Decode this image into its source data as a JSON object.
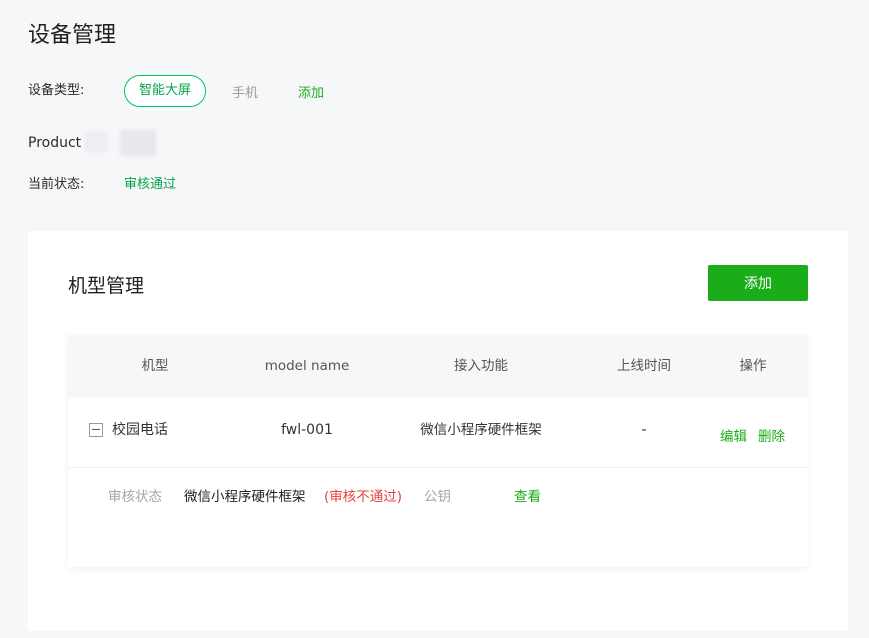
{
  "page": {
    "title": "设备管理"
  },
  "device_type": {
    "label": "设备类型:",
    "options": [
      "智能大屏",
      "手机"
    ],
    "selected": "智能大屏",
    "add_label": "添加"
  },
  "product_id": {
    "label": "Product ID"
  },
  "current_status": {
    "label": "当前状态:",
    "value": "审核通过"
  },
  "models": {
    "title": "机型管理",
    "add_button": "添加",
    "columns": [
      "机型",
      "model name",
      "接入功能",
      "上线时间",
      "操作"
    ],
    "rows": [
      {
        "model": "校园电话",
        "model_name": "fwl-001",
        "feature": "微信小程序硬件框架",
        "online_time": "-",
        "actions": [
          "编辑",
          "删除"
        ],
        "detail": {
          "label": "审核状态",
          "feature": "微信小程序硬件框架",
          "status": "(审核不通过)",
          "key_label": "公钥",
          "view_label": "查看"
        }
      }
    ]
  },
  "colors": {
    "accent": "#1aad19",
    "accent_text": "#07a34d",
    "error": "#e64340",
    "background": "#f6f7f9"
  }
}
